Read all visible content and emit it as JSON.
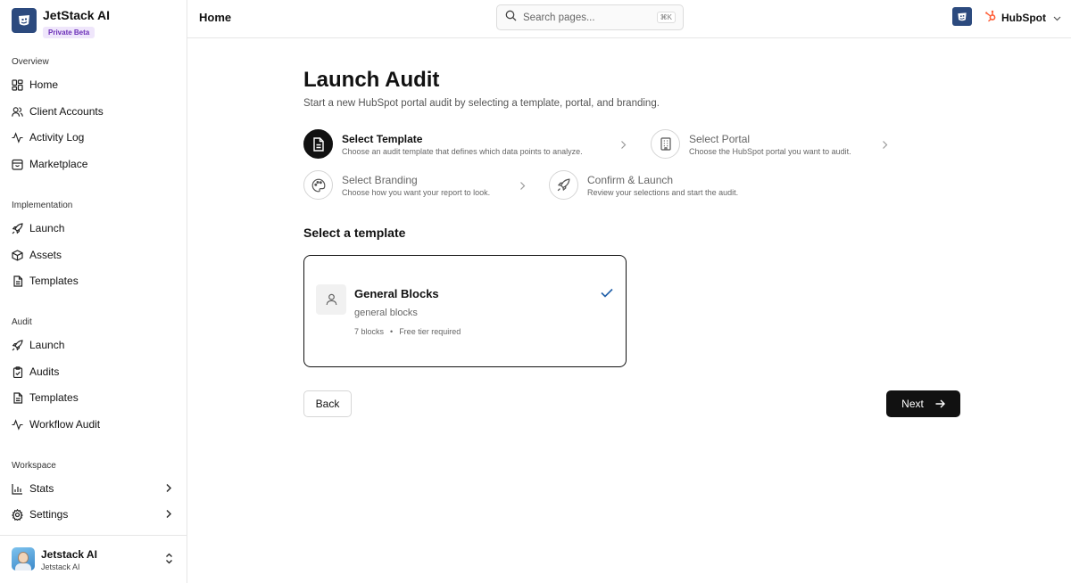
{
  "brand": {
    "name": "JetStack AI",
    "badge": "Private Beta"
  },
  "sidebar": {
    "sections": [
      {
        "title": "Overview",
        "items": [
          {
            "label": "Home",
            "icon": "grid-icon"
          },
          {
            "label": "Client Accounts",
            "icon": "users-icon"
          },
          {
            "label": "Activity Log",
            "icon": "activity-icon"
          },
          {
            "label": "Marketplace",
            "icon": "store-icon"
          }
        ]
      },
      {
        "title": "Implementation",
        "items": [
          {
            "label": "Launch",
            "icon": "rocket-icon"
          },
          {
            "label": "Assets",
            "icon": "package-icon"
          },
          {
            "label": "Templates",
            "icon": "document-icon"
          }
        ]
      },
      {
        "title": "Audit",
        "items": [
          {
            "label": "Launch",
            "icon": "rocket-icon"
          },
          {
            "label": "Audits",
            "icon": "clipboard-check-icon"
          },
          {
            "label": "Templates",
            "icon": "document-icon"
          },
          {
            "label": "Workflow Audit",
            "icon": "activity-icon"
          }
        ]
      },
      {
        "title": "Workspace",
        "items": [
          {
            "label": "Stats",
            "icon": "bar-chart-icon"
          },
          {
            "label": "Settings",
            "icon": "gear-icon"
          }
        ]
      }
    ],
    "user": {
      "name": "Jetstack AI",
      "org": "Jetstack AI"
    }
  },
  "topbar": {
    "title": "Home",
    "search_placeholder": "Search pages...",
    "shortcut": "⌘K",
    "portal_name": "HubSpot"
  },
  "main": {
    "title": "Launch Audit",
    "subtitle": "Start a new HubSpot portal audit by selecting a template, portal, and branding.",
    "steps": [
      {
        "title": "Select Template",
        "desc": "Choose an audit template that defines which data points to analyze.",
        "active": true
      },
      {
        "title": "Select Portal",
        "desc": "Choose the HubSpot portal you want to audit.",
        "active": false
      },
      {
        "title": "Select Branding",
        "desc": "Choose how you want your report to look.",
        "active": false
      },
      {
        "title": "Confirm & Launch",
        "desc": "Review your selections and start the audit.",
        "active": false
      }
    ],
    "section_heading": "Select a template",
    "template": {
      "title": "General Blocks",
      "subtitle": "general blocks",
      "blocks": "7 blocks",
      "separator": "•",
      "tier": "Free tier required",
      "selected": true
    },
    "back_label": "Back",
    "next_label": "Next"
  },
  "colors": {
    "brand": "#2c4a7e",
    "accent": "#1f5fa8",
    "hubspot": "#ff5c35",
    "primary_button": "#111111"
  }
}
